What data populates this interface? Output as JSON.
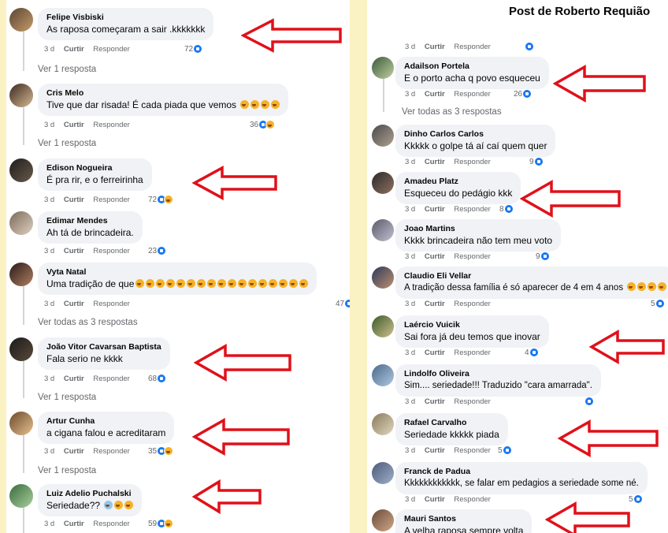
{
  "right_panel": {
    "title": "Post de Roberto Requião"
  },
  "labels": {
    "time": "3 d",
    "like": "Curtir",
    "reply": "Responder"
  },
  "left_comments": [
    {
      "author": "Felipe Visbiski",
      "text": "As raposa começaram a sair .kkkkkkk",
      "count": "72",
      "reactions": [
        "like"
      ]
    },
    {
      "author": "Cris Melo",
      "text": "Tive que dar risada! É cada piada que vemos",
      "text_emojis": 4,
      "count": "36",
      "reactions": [
        "like",
        "haha"
      ]
    },
    {
      "author": "Edison Nogueira",
      "text": "É pra rir, e o ferreirinha",
      "count": "72",
      "reactions": [
        "like",
        "haha"
      ]
    },
    {
      "author": "Edimar Mendes",
      "text": "Ah tá de brincadeira.",
      "count": "23",
      "reactions": [
        "like"
      ]
    },
    {
      "author": "Vyta Natal",
      "text": "Uma tradição de que",
      "text_emojis": 17,
      "count": "47",
      "reactions": [
        "like"
      ]
    },
    {
      "author": "João Vitor Cavarsan Baptista",
      "text": "Fala serio ne kkkk",
      "count": "68",
      "reactions": [
        "like"
      ]
    },
    {
      "author": "Artur Cunha",
      "text": "a cigana falou e acreditaram",
      "count": "35",
      "reactions": [
        "like",
        "haha"
      ]
    },
    {
      "author": "Luiz Adelio Puchalski",
      "text": "Seriedade??",
      "text_emojis": 3,
      "count": "59",
      "reactions": [
        "like",
        "haha"
      ]
    }
  ],
  "left_view_more": [
    "Ver 1 resposta",
    "Ver 1 resposta",
    "Ver todas as 3 respostas",
    "Ver 1 resposta",
    "Ver 1 resposta"
  ],
  "right_top_actions": {
    "count": ""
  },
  "right_comments": [
    {
      "author": "Adailson Portela",
      "text": "E o porto acha q povo esqueceu",
      "count": "26",
      "reactions": [
        "like"
      ]
    },
    {
      "author": "Dinho Carlos Carlos",
      "text": "Kkkkk o golpe tá aí caí quem quer",
      "count": "9",
      "reactions": [
        "like"
      ]
    },
    {
      "author": "Amadeu Platz",
      "text": "Esqueceu do pedágio kkk",
      "count": "8",
      "reactions": [
        "like"
      ]
    },
    {
      "author": "Joao Martins",
      "text": "Kkkk brincadeira não tem meu voto",
      "count": "9",
      "reactions": [
        "like"
      ]
    },
    {
      "author": "Claudio Eli Vellar",
      "text": "A tradição dessa família é só aparecer de 4 em 4 anos",
      "text_emojis": 4,
      "count": "5",
      "reactions": [
        "like"
      ]
    },
    {
      "author": "Laércio Vuicik",
      "text": "Sai fora já deu temos que inovar",
      "count": "4",
      "reactions": [
        "like"
      ]
    },
    {
      "author": "Lindolfo Oliveira",
      "text": "Sim.... seriedade!!! Traduzido \"cara amarrada\".",
      "count": "",
      "reactions": [
        "like"
      ]
    },
    {
      "author": "Rafael Carvalho",
      "text": "Seriedade kkkkk piada",
      "count": "5",
      "reactions": [
        "like"
      ]
    },
    {
      "author": "Franck de Padua",
      "text": "Kkkkkkkkkkkk, se falar em pedagios a seriedade some né.",
      "count": "5",
      "reactions": [
        "like"
      ]
    },
    {
      "author": "Mauri Santos",
      "text": "A velha raposa sempre volta",
      "count": "",
      "reactions": []
    }
  ],
  "right_view_more": [
    "Ver todas as 3 respostas"
  ],
  "colors": {
    "background": "#fbf2c3",
    "arrow": "#e0101a",
    "like": "#1877f2",
    "haha": "#f7b125"
  },
  "icons": {
    "arrow": "left-arrow-outline-icon",
    "like": "like-reaction-icon",
    "haha": "haha-reaction-icon",
    "avatar": "user-avatar"
  }
}
